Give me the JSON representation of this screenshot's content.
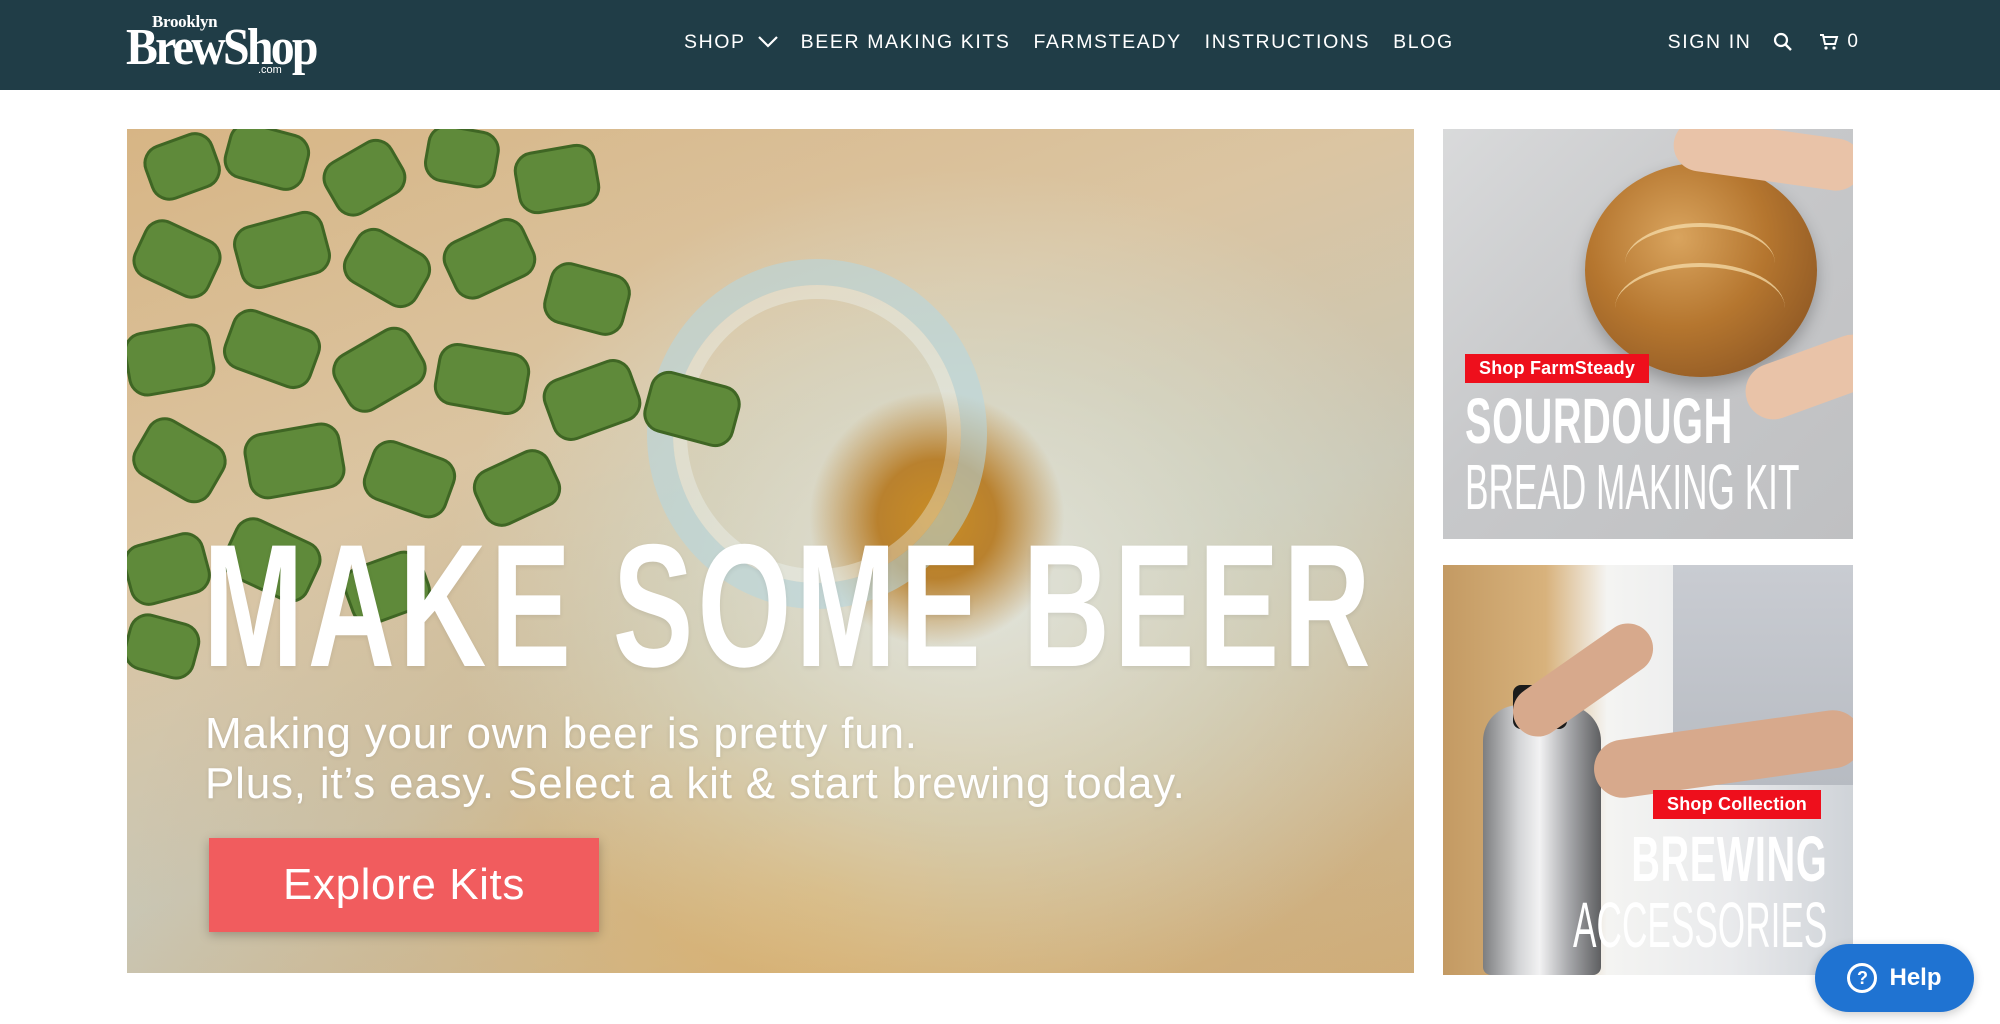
{
  "header": {
    "logo": {
      "top": "Brooklyn",
      "main": "BrewShop",
      "suffix": ".com"
    },
    "nav": [
      {
        "label": "SHOP"
      },
      {
        "label": "BEER MAKING KITS"
      },
      {
        "label": "FARMSTEADY"
      },
      {
        "label": "INSTRUCTIONS"
      },
      {
        "label": "BLOG"
      }
    ],
    "sign_in": "SIGN IN",
    "cart_count": "0"
  },
  "hero": {
    "title": "MAKE SOME BEER",
    "subtitle_line1": "Making your own beer is pretty fun.",
    "subtitle_line2": "Plus, it’s easy. Select a kit & start brewing today.",
    "cta": "Explore Kits"
  },
  "promos": [
    {
      "tag": "Shop FarmSteady",
      "title": "SOURDOUGH",
      "subtitle": "BREAD MAKING KIT"
    },
    {
      "tag": "Shop Collection",
      "title": "BREWING",
      "subtitle": "ACCESSORIES"
    }
  ],
  "help": {
    "label": "Help"
  },
  "colors": {
    "header_bg": "#203d47",
    "cta": "#f15c5e",
    "tag": "#ee0f1c",
    "help": "#1f73d2"
  }
}
